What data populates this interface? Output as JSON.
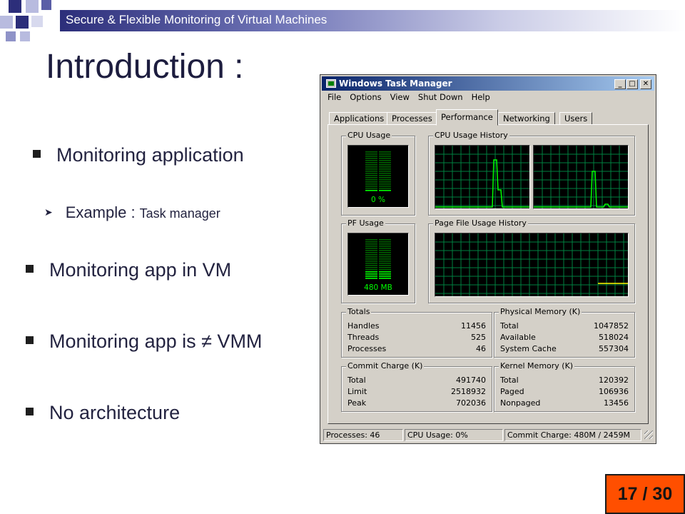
{
  "slide": {
    "header_text": "Secure & Flexible  Monitoring of  Virtual Machines",
    "title": "Introduction :",
    "bullets": [
      "Monitoring application",
      "Monitoring app in VM",
      "Monitoring app is ≠ VMM",
      "No architecture"
    ],
    "sub_bullet": {
      "label": "Example : ",
      "detail": "Task manager"
    },
    "page_number": "17 / 30"
  },
  "taskmgr": {
    "title": "Windows Task Manager",
    "menu": [
      "File",
      "Options",
      "View",
      "Shut Down",
      "Help"
    ],
    "tabs": [
      "Applications",
      "Processes",
      "Performance",
      "Networking",
      "Users"
    ],
    "active_tab": "Performance",
    "cpu_usage": {
      "label": "CPU Usage",
      "value": "0 %",
      "percent": 0
    },
    "cpu_history": {
      "label": "CPU Usage History"
    },
    "pf_usage": {
      "label": "PF Usage",
      "value": "480 MB"
    },
    "pf_history": {
      "label": "Page File Usage History"
    },
    "totals": {
      "label": "Totals",
      "rows": [
        {
          "k": "Handles",
          "v": "11456"
        },
        {
          "k": "Threads",
          "v": "525"
        },
        {
          "k": "Processes",
          "v": "46"
        }
      ]
    },
    "physical_memory": {
      "label": "Physical Memory (K)",
      "rows": [
        {
          "k": "Total",
          "v": "1047852"
        },
        {
          "k": "Available",
          "v": "518024"
        },
        {
          "k": "System Cache",
          "v": "557304"
        }
      ]
    },
    "commit_charge": {
      "label": "Commit Charge (K)",
      "rows": [
        {
          "k": "Total",
          "v": "491740"
        },
        {
          "k": "Limit",
          "v": "2518932"
        },
        {
          "k": "Peak",
          "v": "702036"
        }
      ]
    },
    "kernel_memory": {
      "label": "Kernel Memory (K)",
      "rows": [
        {
          "k": "Total",
          "v": "120392"
        },
        {
          "k": "Paged",
          "v": "106936"
        },
        {
          "k": "Nonpaged",
          "v": "13456"
        }
      ]
    },
    "status": {
      "processes": "Processes: 46",
      "cpu": "CPU Usage: 0%",
      "commit": "Commit Charge: 480M / 2459M"
    },
    "colors": {
      "graph_bg": "#000000",
      "grid": "#008040",
      "line": "#00ff00",
      "pf_line": "#ffff00",
      "title_start": "#0a246a",
      "title_end": "#a6caf0"
    }
  }
}
